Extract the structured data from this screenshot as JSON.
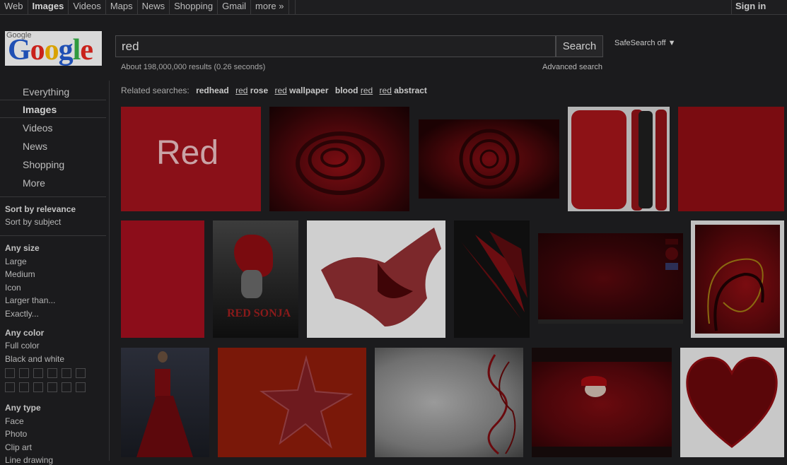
{
  "topnav": {
    "items": [
      "Web",
      "Images",
      "Videos",
      "Maps",
      "News",
      "Shopping",
      "Gmail",
      "more »"
    ],
    "active": "Images",
    "sign_in": "Sign in"
  },
  "logo": {
    "small_text": "Google",
    "word": "Google"
  },
  "search": {
    "query": "red",
    "button": "Search",
    "safesearch": "SafeSearch off ▼",
    "stats": "About 198,000,000 results (0.26 seconds)",
    "advanced": "Advanced search"
  },
  "modes": [
    "Everything",
    "Images",
    "Videos",
    "News",
    "Shopping",
    "More"
  ],
  "sort": {
    "relevance": "Sort by relevance",
    "subject": "Sort by subject"
  },
  "size": {
    "title": "Any size",
    "options": [
      "Large",
      "Medium",
      "Icon",
      "Larger than...",
      "Exactly..."
    ]
  },
  "color": {
    "title": "Any color",
    "options": [
      "Full color",
      "Black and white"
    ]
  },
  "type": {
    "title": "Any type",
    "options": [
      "Face",
      "Photo",
      "Clip art",
      "Line drawing"
    ]
  },
  "related": {
    "label": "Related searches:",
    "items": [
      {
        "pre": "",
        "bold": "redhead"
      },
      {
        "pre": "red",
        "bold": " rose"
      },
      {
        "pre": "red",
        "bold": " wallpaper"
      },
      {
        "pre": "",
        "bold": "blood ",
        "post": "red"
      },
      {
        "pre": "red",
        "bold": " abstract"
      }
    ]
  },
  "thumb_text": {
    "red_text": "Red",
    "sonja": "RED SONJA"
  },
  "colors": {
    "background": "#1b1b1d",
    "accent_red": "#8f0f14",
    "text": "#bdbdbd"
  }
}
